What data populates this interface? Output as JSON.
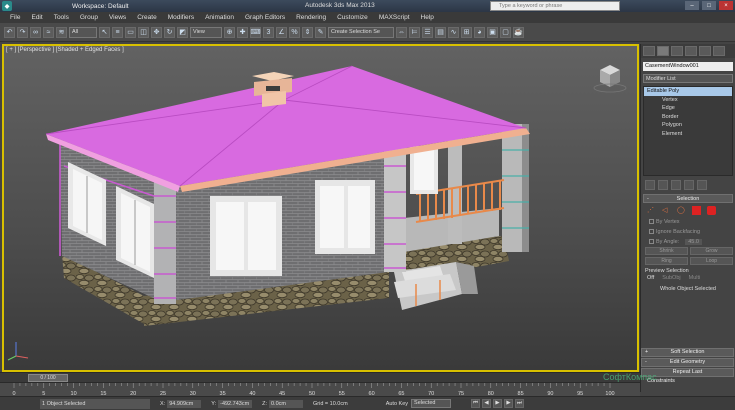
{
  "titlebar": {
    "workspace": "Workspace: Default",
    "title": "Autodesk 3ds Max  2013",
    "search_placeholder": "Type a keyword or phrase"
  },
  "menu": [
    "File",
    "Edit",
    "Tools",
    "Group",
    "Views",
    "Create",
    "Modifiers",
    "Animation",
    "Graph Editors",
    "Rendering",
    "Customize",
    "MAXScript",
    "Help"
  ],
  "toolbar": {
    "filter": "All",
    "refcoord": "View",
    "selection_set": "Create Selection Se"
  },
  "viewport": {
    "label": "[ + ] [Perspective ] [Shaded + Edged Faces ]"
  },
  "command_panel": {
    "object_name": "CasementWindow001",
    "modifier_list": "Modifier List",
    "stack_top": "Editable Poly",
    "stack_items": [
      "Vertex",
      "Edge",
      "Border",
      "Polygon",
      "Element"
    ],
    "selection_title": "Selection",
    "by_vertex": "By Vertex",
    "ignore_backfacing": "Ignore Backfacing",
    "by_angle": "By Angle:",
    "angle_value": "45.0",
    "shrink": "Shrink",
    "grow": "Grow",
    "ring": "Ring",
    "loop": "Loop",
    "preview_selection": "Preview Selection",
    "radio_off": "Off",
    "radio_subobj": "SubObj",
    "radio_multi": "Multi",
    "whole_object": "Whole Object Selected",
    "soft_selection": "Soft Selection",
    "edit_geometry": "Edit Geometry",
    "repeat_last": "Repeat Last",
    "constraints": "Constraints"
  },
  "timeline": {
    "frame": "0 / 100"
  },
  "ruler_ticks": [
    "0",
    "5",
    "10",
    "15",
    "20",
    "25",
    "30",
    "35",
    "40",
    "45",
    "50",
    "55",
    "60",
    "65",
    "70",
    "75",
    "80",
    "85",
    "90",
    "95",
    "100"
  ],
  "status": {
    "selected": "1 Object Selected",
    "x_label": "X:",
    "x_value": "94.909cm",
    "y_label": "Y:",
    "y_value": "-492.743cm",
    "z_label": "Z:",
    "z_value": "0.0cm",
    "grid": "Grid = 10.0cm",
    "auto_key": "Auto Key",
    "selected_dropdown": "Selected"
  },
  "watermark": "СофтКомпас"
}
